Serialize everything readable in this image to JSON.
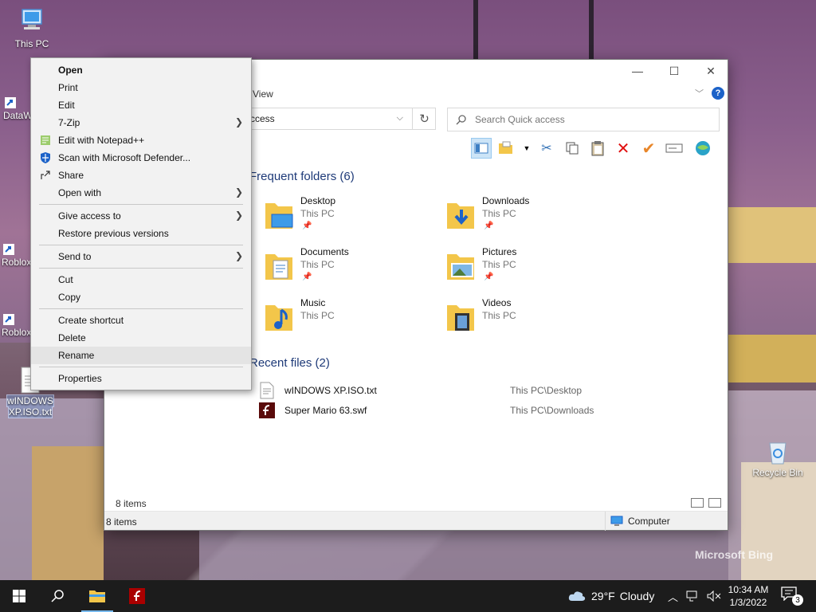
{
  "desktop": {
    "icons": [
      {
        "label": "This PC",
        "icon": "computer-icon"
      },
      {
        "label": "DataW",
        "icon": "shortcut-icon"
      },
      {
        "label": "Roblox",
        "icon": "shortcut-icon"
      },
      {
        "label": "Roblox",
        "icon": "shortcut-icon"
      },
      {
        "label": "wINDOWS XP.ISO.txt",
        "icon": "text-file-icon"
      },
      {
        "label": "Recycle Bin",
        "icon": "recycle-bin-icon"
      }
    ],
    "watermark": "Microsoft Bing"
  },
  "context_menu": {
    "items": [
      {
        "label": "Open",
        "bold": true
      },
      {
        "label": "Print"
      },
      {
        "label": "Edit"
      },
      {
        "label": "7-Zip",
        "submenu": true
      },
      {
        "label": "Edit with Notepad++",
        "icon": "notepadpp-icon"
      },
      {
        "label": "Scan with Microsoft Defender...",
        "icon": "defender-shield-icon"
      },
      {
        "label": "Share",
        "icon": "share-icon"
      },
      {
        "label": "Open with",
        "submenu": true
      },
      {
        "label": "Give access to",
        "submenu": true
      },
      {
        "label": "Restore previous versions"
      },
      {
        "label": "Send to",
        "submenu": true
      },
      {
        "label": "Cut"
      },
      {
        "label": "Copy"
      },
      {
        "label": "Create shortcut"
      },
      {
        "label": "Delete"
      },
      {
        "label": "Rename",
        "hover": true
      },
      {
        "label": "Properties"
      }
    ]
  },
  "explorer": {
    "ribbon_tab": "View",
    "address": "ccess",
    "search_placeholder": "Search Quick access",
    "frequent_header": "Frequent folders (6)",
    "folders": [
      {
        "name": "Desktop",
        "location": "This PC",
        "pinned": true
      },
      {
        "name": "Downloads",
        "location": "This PC",
        "pinned": true
      },
      {
        "name": "Documents",
        "location": "This PC",
        "pinned": true
      },
      {
        "name": "Pictures",
        "location": "This PC",
        "pinned": true
      },
      {
        "name": "Music",
        "location": "This PC",
        "pinned": false
      },
      {
        "name": "Videos",
        "location": "This PC",
        "pinned": false
      }
    ],
    "recent_header": "Recent files (2)",
    "recent_files": [
      {
        "name": "wINDOWS XP.ISO.txt",
        "path": "This PC\\Desktop",
        "icon": "text-file-icon"
      },
      {
        "name": "Super Mario 63.swf",
        "path": "This PC\\Downloads",
        "icon": "flash-file-icon"
      }
    ],
    "item_count": "8 items",
    "status_count": "8 items",
    "status_zone": "Computer"
  },
  "taskbar": {
    "weather_temp": "29°F",
    "weather_desc": "Cloudy",
    "time": "10:34 AM",
    "date": "1/3/2022",
    "notification_count": "3"
  },
  "colors": {
    "accent": "#1c62c8",
    "folder_yellow": "#f3c64a",
    "taskbar": "#1c1c1c",
    "group_header": "#1e3a78"
  }
}
